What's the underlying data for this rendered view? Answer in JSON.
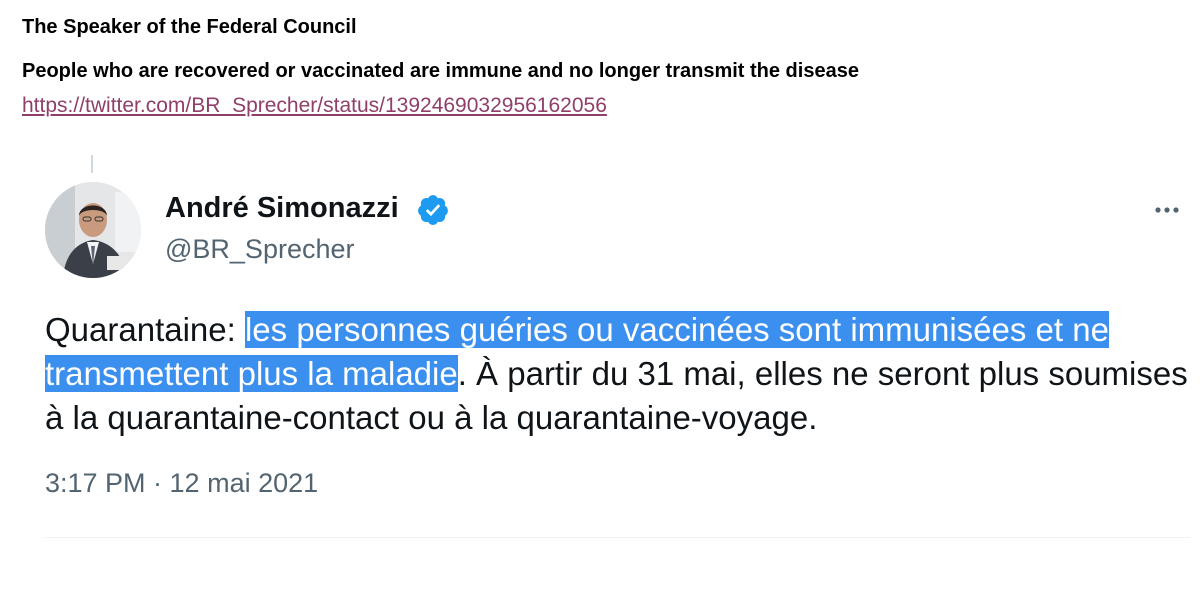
{
  "header": {
    "title": "The Speaker of the Federal Council",
    "claim": "People who are recovered or vaccinated are immune and no longer transmit the disease",
    "link": "https://twitter.com/BR_Sprecher/status/1392469032956162056"
  },
  "tweet": {
    "display_name": "André Simonazzi",
    "handle": "@BR_Sprecher",
    "verified": true,
    "avatar_icon": "profile-photo",
    "more_icon": "more-options-icon",
    "text": {
      "prefix": "Quarantaine: ",
      "highlighted": "les personnes guéries ou vaccinées sont immunisées et ne transmettent plus la maladie",
      "suffix": ". À partir du 31 mai, elles ne seront plus soumises à la quarantaine-contact ou à la quarantaine-voyage."
    },
    "timestamp": "3:17 PM · 12 mai 2021"
  },
  "colors": {
    "highlight": "#3b8fee",
    "link": "#8f3f6a",
    "verified": "#1d9bf0",
    "secondary_text": "#536471",
    "primary_text": "#0f1419"
  }
}
